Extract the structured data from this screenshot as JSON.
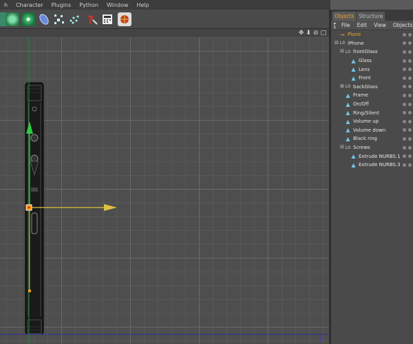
{
  "menu": [
    "h",
    "Character",
    "Plugins",
    "Python",
    "Window",
    "Help"
  ],
  "toolbar_icons": [
    "cube-tool-icon",
    "gear-flower-icon",
    "gear-green-icon",
    "capsule-icon",
    "scatter-icon",
    "particles-icon",
    "help-question-icon",
    "calculator-icon",
    "render-sphere-icon"
  ],
  "viewport_icons": [
    "✥",
    "⬇",
    "⊘",
    "▢"
  ],
  "axis_label": "Z",
  "panel": {
    "tabs": [
      "Objects",
      "Structure"
    ],
    "menu": [
      "File",
      "Edit",
      "View",
      "Objects"
    ]
  },
  "tree": [
    {
      "label": "Plane",
      "depth": 0,
      "exp": "",
      "icon": "plane-icon",
      "glyph": "⊸",
      "selected": true
    },
    {
      "label": "iPhone",
      "depth": 0,
      "exp": "⊟",
      "icon": "null-object-icon",
      "glyph": "L0",
      "selected": false
    },
    {
      "label": "frontGlass",
      "depth": 1,
      "exp": "⊟",
      "icon": "null-object-icon",
      "glyph": "L0",
      "selected": false
    },
    {
      "label": "Glass",
      "depth": 2,
      "exp": "",
      "icon": "polygon-object-icon",
      "glyph": "▲",
      "selected": false
    },
    {
      "label": "Lens",
      "depth": 2,
      "exp": "",
      "icon": "polygon-object-icon",
      "glyph": "▲",
      "selected": false
    },
    {
      "label": "Front",
      "depth": 2,
      "exp": "",
      "icon": "polygon-object-icon",
      "glyph": "▲",
      "selected": false
    },
    {
      "label": "backGlass",
      "depth": 1,
      "exp": "⊞",
      "icon": "null-object-icon",
      "glyph": "L0",
      "selected": false
    },
    {
      "label": "Frame",
      "depth": 1,
      "exp": "",
      "icon": "polygon-object-icon",
      "glyph": "▲",
      "selected": false
    },
    {
      "label": "On/Off",
      "depth": 1,
      "exp": "",
      "icon": "polygon-object-icon",
      "glyph": "▲",
      "selected": false
    },
    {
      "label": "Ring/Silent",
      "depth": 1,
      "exp": "",
      "icon": "polygon-object-icon",
      "glyph": "▲",
      "selected": false
    },
    {
      "label": "Volume up",
      "depth": 1,
      "exp": "",
      "icon": "polygon-object-icon",
      "glyph": "▲",
      "selected": false
    },
    {
      "label": "Volume down",
      "depth": 1,
      "exp": "",
      "icon": "polygon-object-icon",
      "glyph": "▲",
      "selected": false
    },
    {
      "label": "Black ring",
      "depth": 1,
      "exp": "",
      "icon": "polygon-object-icon",
      "glyph": "▲",
      "selected": false
    },
    {
      "label": "Screws",
      "depth": 1,
      "exp": "⊟",
      "icon": "null-object-icon",
      "glyph": "L0",
      "selected": false
    },
    {
      "label": "Extrude NURBS.1",
      "depth": 2,
      "exp": "",
      "icon": "polygon-object-icon",
      "glyph": "▲",
      "selected": false
    },
    {
      "label": "Extrude NURBS.3",
      "depth": 2,
      "exp": "",
      "icon": "polygon-object-icon",
      "glyph": "▲",
      "selected": false
    }
  ],
  "colors": {
    "accent": "#f5a623",
    "selection": "#f0a030",
    "axis_y": "#2ecc40",
    "axis_x": "#e0c040"
  }
}
